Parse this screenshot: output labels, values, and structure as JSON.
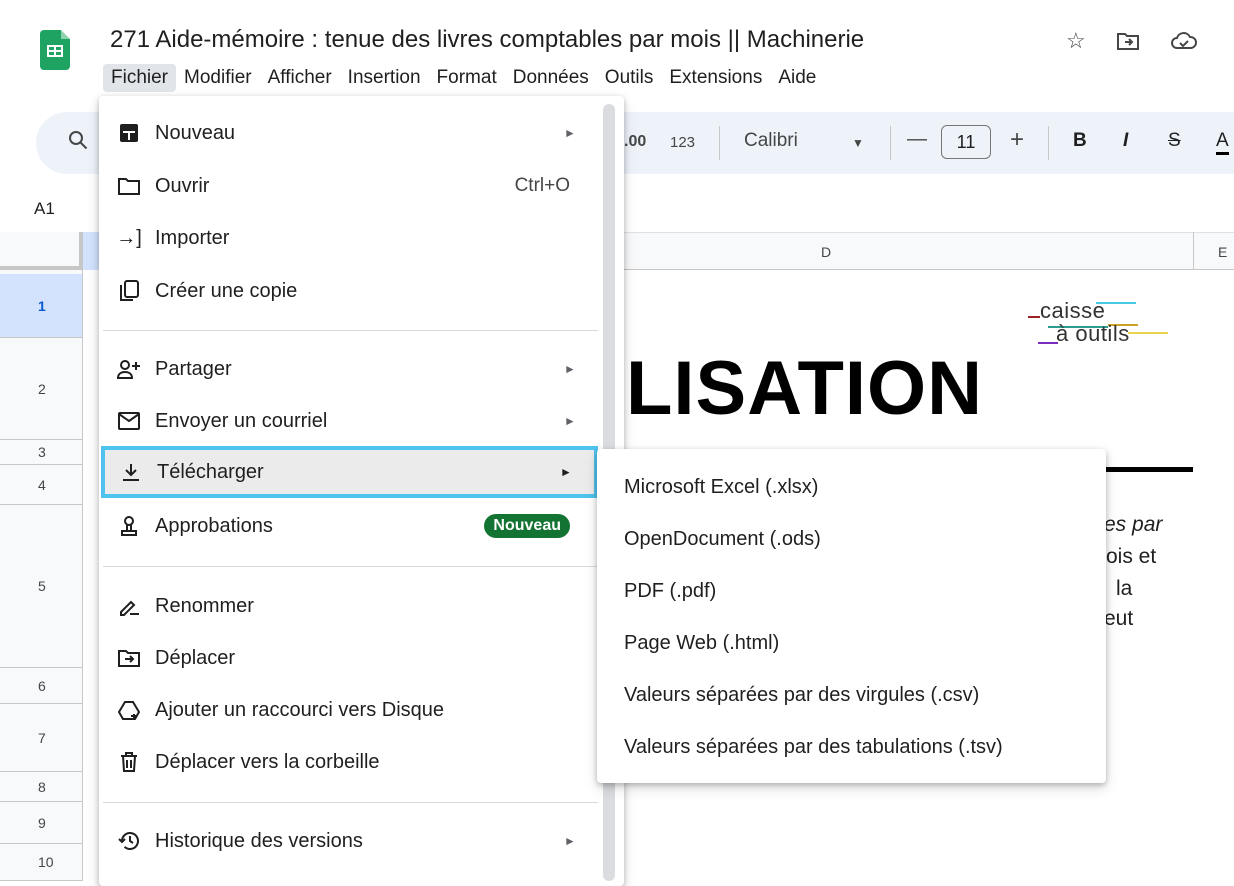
{
  "header": {
    "title": "271 Aide-mémoire : tenue des livres comptables par mois || Machinerie",
    "icons": [
      "star-icon",
      "move-to-folder-icon",
      "cloud-status-icon"
    ]
  },
  "menubar": {
    "items": [
      "Fichier",
      "Modifier",
      "Afficher",
      "Insertion",
      "Format",
      "Données",
      "Outils",
      "Extensions",
      "Aide"
    ]
  },
  "toolbar": {
    "decimal_label": ".00",
    "number_format": "123",
    "font_name": "Calibri",
    "font_size": "11",
    "minus": "—",
    "plus": "+",
    "bold": "B",
    "italic": "I",
    "strike": "S",
    "text_color": "A"
  },
  "sheet": {
    "name_box": "A1",
    "columns": [
      "D",
      "E"
    ],
    "rows": [
      "1",
      "2",
      "3",
      "4",
      "5",
      "6",
      "7",
      "8",
      "9",
      "10"
    ],
    "selected_row": "1",
    "logo_line1": "caisse",
    "logo_line2": "à outils",
    "heading_fragment": "LISATION",
    "text_fragments": [
      "es par",
      "ois et",
      "la",
      "eut"
    ]
  },
  "file_menu": {
    "items": [
      {
        "label": "Nouveau",
        "icon": "new-sheet-icon",
        "has_submenu": true
      },
      {
        "label": "Ouvrir",
        "icon": "folder-icon",
        "shortcut": "Ctrl+O"
      },
      {
        "label": "Importer",
        "icon": "import-icon"
      },
      {
        "label": "Créer une copie",
        "icon": "copy-icon"
      },
      {
        "label": "Partager",
        "icon": "share-person-icon",
        "has_submenu": true
      },
      {
        "label": "Envoyer un courriel",
        "icon": "mail-icon",
        "has_submenu": true
      },
      {
        "label": "Télécharger",
        "icon": "download-icon",
        "has_submenu": true,
        "highlighted": true
      },
      {
        "label": "Approbations",
        "icon": "approvals-icon",
        "badge": "Nouveau"
      },
      {
        "label": "Renommer",
        "icon": "rename-icon"
      },
      {
        "label": "Déplacer",
        "icon": "move-folder-icon"
      },
      {
        "label": "Ajouter un raccourci vers Disque",
        "icon": "drive-shortcut-icon"
      },
      {
        "label": "Déplacer vers la corbeille",
        "icon": "trash-icon"
      },
      {
        "label": "Historique des versions",
        "icon": "history-icon",
        "has_submenu": true
      }
    ]
  },
  "download_submenu": {
    "items": [
      "Microsoft Excel (.xlsx)",
      "OpenDocument (.ods)",
      "PDF (.pdf)",
      "Page Web (.html)",
      "Valeurs séparées par des virgules (.csv)",
      "Valeurs séparées par des tabulations (.tsv)"
    ]
  },
  "colors": {
    "highlight_border": "#4fc3ee",
    "badge_green": "#137333",
    "sheets_green": "#1ea362",
    "selection_blue": "#d3e3fd"
  }
}
